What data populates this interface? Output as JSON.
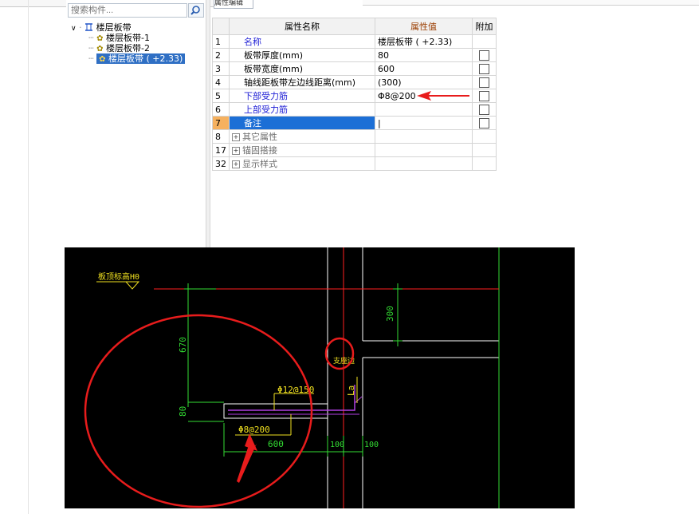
{
  "search": {
    "placeholder": "搜索构件..."
  },
  "tab": {
    "label": "属性编辑"
  },
  "tree": {
    "root": "楼层板带",
    "items": [
      "楼层板带-1",
      "楼层板带-2",
      "楼层板带 ( +2.33)"
    ],
    "selected_index": 2
  },
  "grid": {
    "headers": [
      "属性名称",
      "属性值",
      "附加"
    ],
    "rows": [
      {
        "no": "1",
        "name": "名称",
        "value": "楼层板带 ( +2.33)",
        "checkbox": false,
        "style": "blue"
      },
      {
        "no": "2",
        "name": "板带厚度(mm)",
        "value": "80",
        "checkbox": true,
        "checked": false,
        "style": "black"
      },
      {
        "no": "3",
        "name": "板带宽度(mm)",
        "value": "600",
        "checkbox": true,
        "checked": false,
        "style": "black"
      },
      {
        "no": "4",
        "name": "轴线距板带左边线距离(mm)",
        "value": "(300)",
        "checkbox": true,
        "checked": false,
        "style": "black"
      },
      {
        "no": "5",
        "name": "下部受力筋",
        "value": "Φ8@200",
        "checkbox": true,
        "checked": false,
        "style": "blue"
      },
      {
        "no": "6",
        "name": "上部受力筋",
        "value": "",
        "checkbox": true,
        "checked": false,
        "style": "blue"
      },
      {
        "no": "7",
        "name": "备注",
        "value": "|",
        "checkbox": true,
        "checked": false,
        "style": "selected"
      },
      {
        "no": "8",
        "name": "其它属性",
        "value": "",
        "checkbox": false,
        "style": "group"
      },
      {
        "no": "17",
        "name": "锚固搭接",
        "value": "",
        "checkbox": false,
        "style": "group"
      },
      {
        "no": "32",
        "name": "显示样式",
        "value": "",
        "checkbox": false,
        "style": "group"
      }
    ]
  },
  "cad": {
    "label_level": "板顶标高H0",
    "dim_670": "670",
    "dim_80": "80",
    "dim_300": "300",
    "dim_600": "600",
    "dim_100a": "100",
    "dim_100b": "100",
    "rebar_top": "Φ12@150",
    "rebar_bottom": "Φ8@200",
    "la": "La",
    "support_label": "支座边",
    "colors": {
      "background": "#000000",
      "dimension": "#33dd33",
      "axis": "#ff2020",
      "annotation": "#f0e020",
      "outline": "#ffffff",
      "rebar": "#b040e0"
    }
  }
}
